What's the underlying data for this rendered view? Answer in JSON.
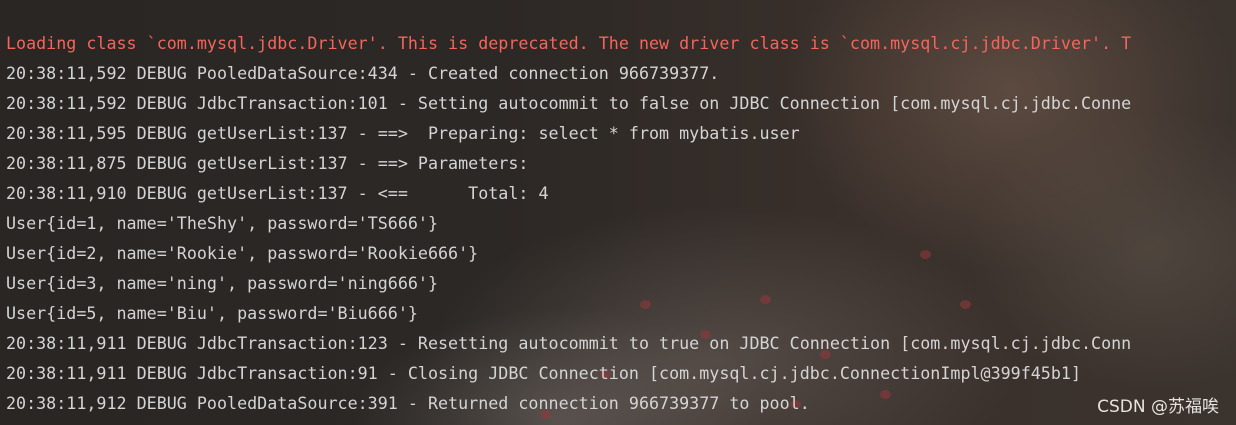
{
  "console": {
    "lines": [
      {
        "text": "Loading class `com.mysql.jdbc.Driver'. This is deprecated. The new driver class is `com.mysql.cj.jdbc.Driver'. T",
        "level": "warn"
      },
      {
        "text": "20:38:11,592 DEBUG PooledDataSource:434 - Created connection 966739377.",
        "level": "debug"
      },
      {
        "text": "20:38:11,592 DEBUG JdbcTransaction:101 - Setting autocommit to false on JDBC Connection [com.mysql.cj.jdbc.Conne",
        "level": "debug"
      },
      {
        "text": "20:38:11,595 DEBUG getUserList:137 - ==>  Preparing: select * from mybatis.user",
        "level": "debug"
      },
      {
        "text": "20:38:11,875 DEBUG getUserList:137 - ==> Parameters: ",
        "level": "debug"
      },
      {
        "text": "20:38:11,910 DEBUG getUserList:137 - <==      Total: 4",
        "level": "debug"
      },
      {
        "text": "User{id=1, name='TheShy', password='TS666'}",
        "level": "out"
      },
      {
        "text": "User{id=2, name='Rookie', password='Rookie666'}",
        "level": "out"
      },
      {
        "text": "User{id=3, name='ning', password='ning666'}",
        "level": "out"
      },
      {
        "text": "User{id=5, name='Biu', password='Biu666'}",
        "level": "out"
      },
      {
        "text": "20:38:11,911 DEBUG JdbcTransaction:123 - Resetting autocommit to true on JDBC Connection [com.mysql.cj.jdbc.Conn",
        "level": "debug"
      },
      {
        "text": "20:38:11,911 DEBUG JdbcTransaction:91 - Closing JDBC Connection [com.mysql.cj.jdbc.ConnectionImpl@399f45b1]",
        "level": "debug"
      },
      {
        "text": "20:38:11,912 DEBUG PooledDataSource:391 - Returned connection 966739377 to pool.",
        "level": "debug"
      }
    ]
  },
  "watermark": "CSDN @苏福唉",
  "colors": {
    "warn": "#f2665c",
    "text": "#d4d4d4"
  }
}
